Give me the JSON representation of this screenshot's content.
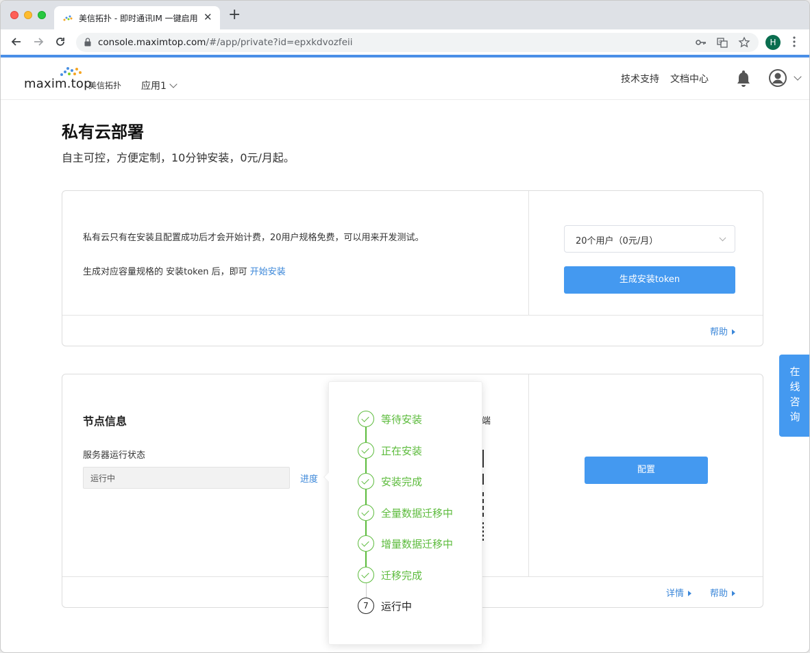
{
  "browser": {
    "tab_title": "美信拓扑 - 即时通讯IM 一键启用",
    "tab_close": "✕",
    "new_tab": "+",
    "url_host": "console.maximtop.com",
    "url_path": "/#/app/private?id=epxkdvozfeii",
    "profile_initial": "H"
  },
  "header": {
    "logo_text": "maxim.top",
    "logo_cn": "美信拓扑",
    "app_selector": "应用1",
    "links": [
      "技术支持",
      "文档中心"
    ]
  },
  "page": {
    "title": "私有云部署",
    "subtitle": "自主可控，方便定制，10分钟安装，0元/月起。"
  },
  "card1": {
    "line1": "私有云只有在安装且配置成功后才会开始计费，20用户规格免费，可以用来开发测试。",
    "line2_prefix": "生成对应容量规格的 安装token 后，即可 ",
    "line2_link": "开始安装",
    "select_value": "20个用户（0元/月）",
    "generate_button": "生成安装token",
    "help_link": "帮助"
  },
  "card2": {
    "section_title": "节点信息",
    "field_label": "服务器运行状态",
    "field_value": "运行中",
    "progress_link": "进度",
    "peek_text": "端",
    "config_button": "配置",
    "detail_link": "详情",
    "help_link": "帮助"
  },
  "progress_steps": [
    {
      "label": "等待安装",
      "status": "done"
    },
    {
      "label": "正在安装",
      "status": "done"
    },
    {
      "label": "安装完成",
      "status": "done"
    },
    {
      "label": "全量数据迁移中",
      "status": "done"
    },
    {
      "label": "增量数据迁移中",
      "status": "done"
    },
    {
      "label": "迁移完成",
      "status": "done"
    },
    {
      "label": "运行中",
      "status": "current",
      "number": "7"
    }
  ],
  "consult": {
    "label": "在线咨询"
  },
  "colors": {
    "primary": "#4499f0",
    "link": "#3b87d9",
    "success": "#5cbb3c"
  }
}
